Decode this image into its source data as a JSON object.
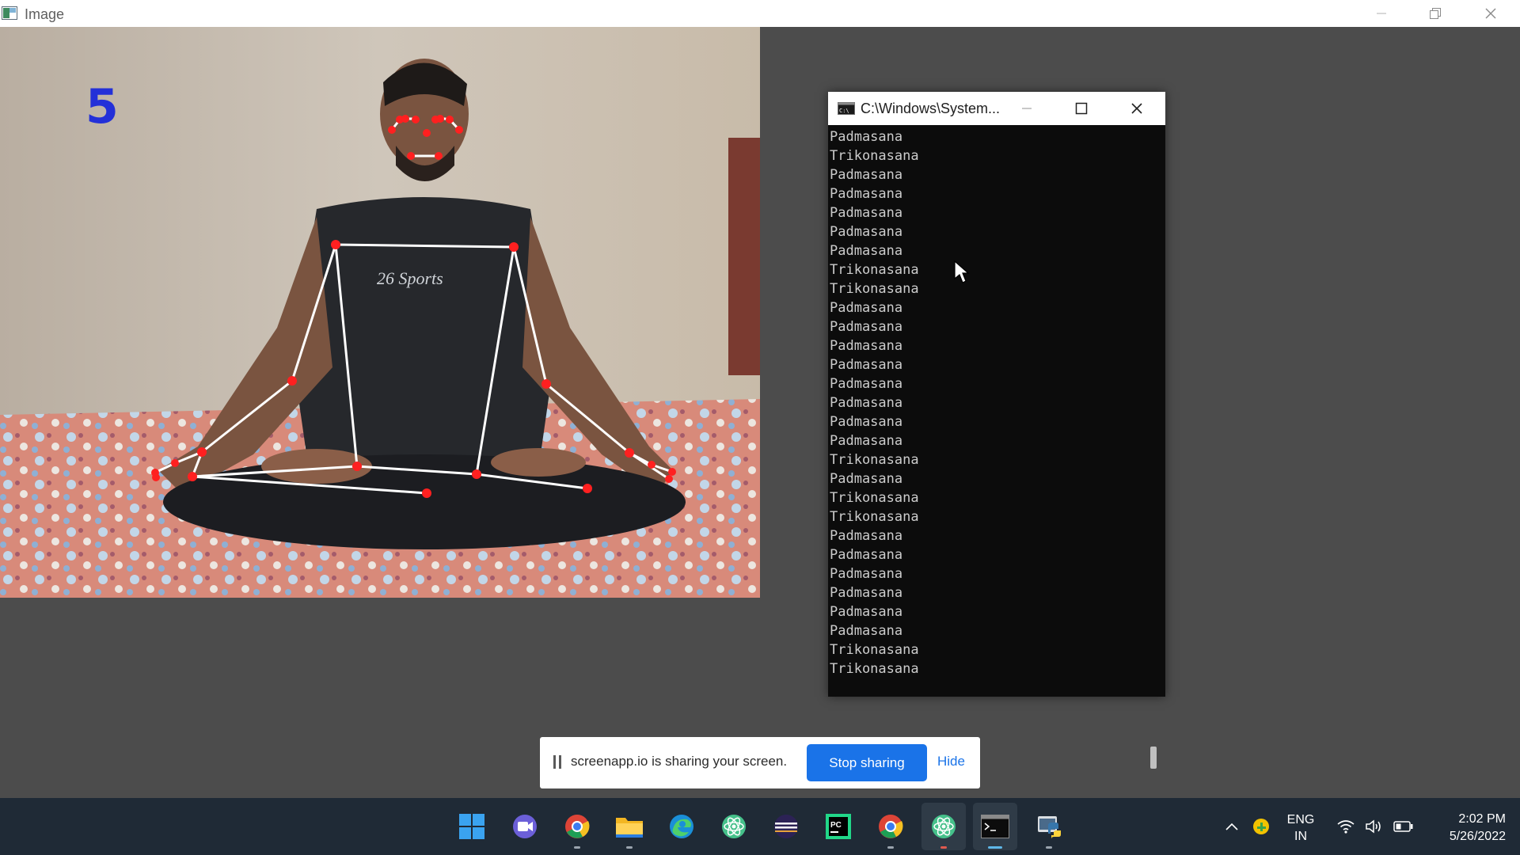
{
  "window": {
    "title": "Image"
  },
  "camera": {
    "pose_counter": "5"
  },
  "console": {
    "title": "C:\\Windows\\System...",
    "lines": [
      "Padmasana",
      "Trikonasana",
      "Padmasana",
      "Padmasana",
      "Padmasana",
      "Padmasana",
      "Padmasana",
      "Trikonasana",
      "Trikonasana",
      "Padmasana",
      "Padmasana",
      "Padmasana",
      "Padmasana",
      "Padmasana",
      "Padmasana",
      "Padmasana",
      "Padmasana",
      "Trikonasana",
      "Padmasana",
      "Trikonasana",
      "Trikonasana",
      "Padmasana",
      "Padmasana",
      "Padmasana",
      "Padmasana",
      "Padmasana",
      "Padmasana",
      "Trikonasana",
      "Trikonasana"
    ]
  },
  "share_bar": {
    "message": "screenapp.io is sharing your screen.",
    "stop_label": "Stop sharing",
    "hide_label": "Hide"
  },
  "taskbar": {
    "apps": [
      {
        "name": "start",
        "icon": "windows-start-icon"
      },
      {
        "name": "teams-chat",
        "icon": "video-chat-icon"
      },
      {
        "name": "chrome",
        "icon": "chrome-icon"
      },
      {
        "name": "file-explorer",
        "icon": "folder-icon"
      },
      {
        "name": "edge",
        "icon": "edge-icon"
      },
      {
        "name": "atom",
        "icon": "atom-icon"
      },
      {
        "name": "eclipse",
        "icon": "eclipse-icon"
      },
      {
        "name": "pycharm",
        "icon": "pycharm-icon"
      },
      {
        "name": "chrome-2",
        "icon": "chrome-icon"
      },
      {
        "name": "atom-2",
        "icon": "atom-icon"
      },
      {
        "name": "terminal",
        "icon": "terminal-icon"
      },
      {
        "name": "python",
        "icon": "python-icon"
      }
    ],
    "tray": {
      "lang_top": "ENG",
      "lang_bottom": "IN",
      "time": "2:02 PM",
      "date": "5/26/2022"
    }
  }
}
